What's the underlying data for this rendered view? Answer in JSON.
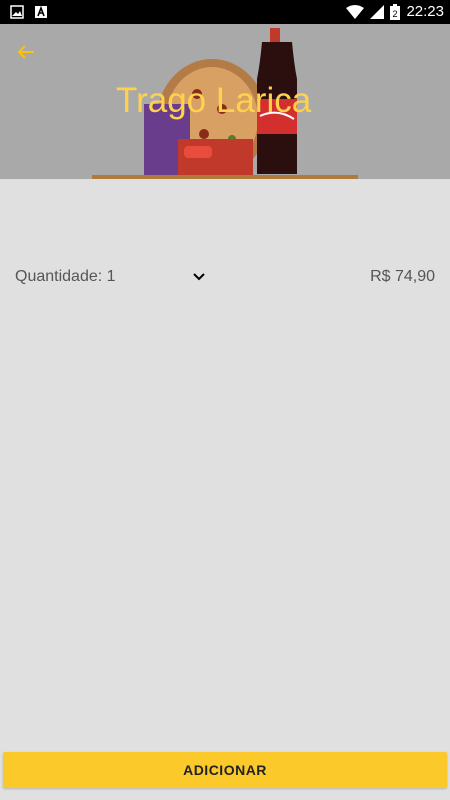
{
  "status_bar": {
    "time": "22:23",
    "battery": "2"
  },
  "header": {
    "title": "Trago Larica",
    "back_icon": "arrow-back-icon",
    "image": "pizza-soda-chocolate-combo"
  },
  "order": {
    "quantity_label": "Quantidade: 1",
    "price": "R$ 74,90",
    "dropdown_icon": "chevron-down-icon"
  },
  "actions": {
    "add_label": "ADICIONAR"
  },
  "colors": {
    "accent": "#ffd24d",
    "button": "#fcc92a",
    "background": "#e0e0e0"
  }
}
